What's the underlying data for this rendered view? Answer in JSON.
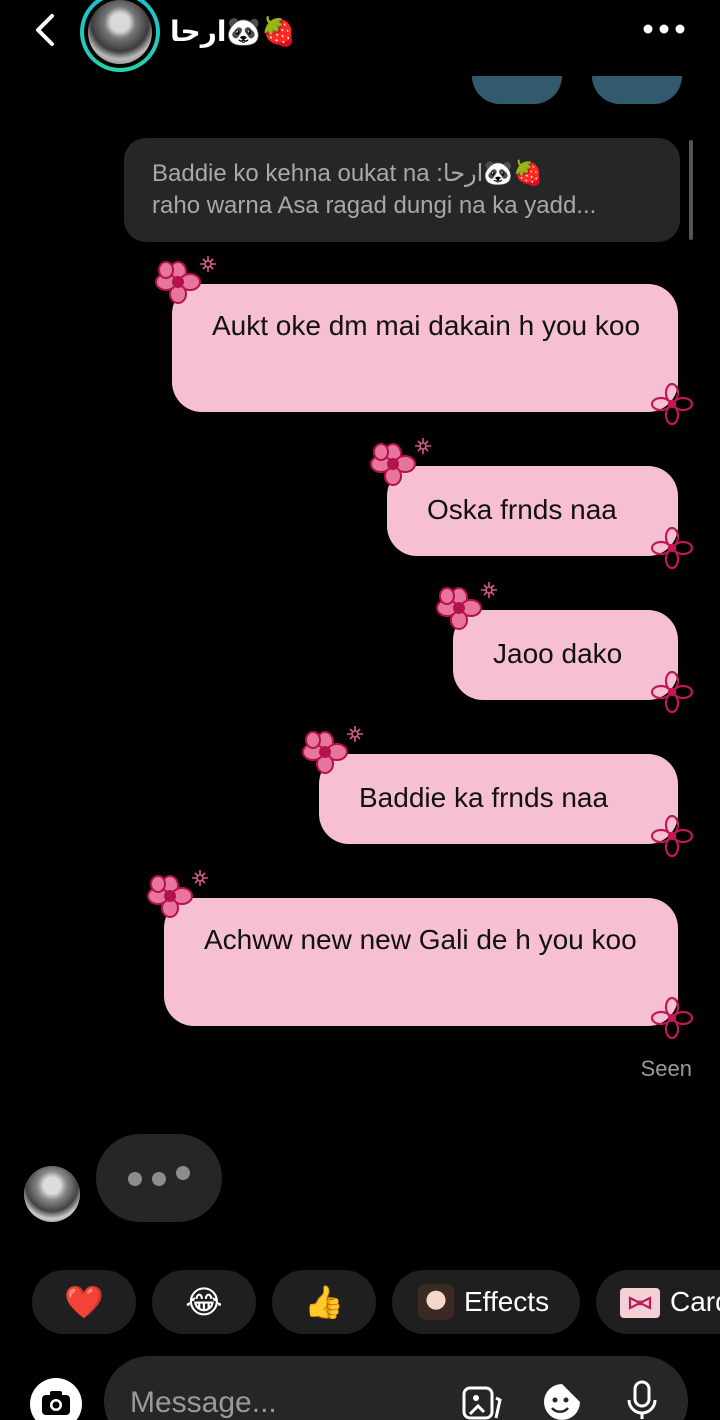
{
  "header": {
    "contact_name": "ارحا🐼🍓"
  },
  "reply_preview": {
    "line1": "Baddie ko kehna oukat na :ارحا🐼🍓",
    "line2": "raho warna Asa ragad dungi na ka yadd..."
  },
  "messages": [
    {
      "text": "Aukt oke dm mai dakain h you koo"
    },
    {
      "text": "Oska frnds naa"
    },
    {
      "text": "Jaoo dako"
    },
    {
      "text": "Baddie ka frnds naa"
    },
    {
      "text": "Achww new new Gali de h you koo"
    }
  ],
  "seen_label": "Seen",
  "quick_reactions": {
    "heart": "❤️",
    "laugh": "😂",
    "thumbs_up": "👍",
    "effects_label": "Effects",
    "cards_label": "Card"
  },
  "composer": {
    "placeholder": "Message..."
  },
  "colors": {
    "bubble": "#f7bfd2",
    "flower": "#c2185b",
    "avatar_ring": "#16c0d8"
  }
}
